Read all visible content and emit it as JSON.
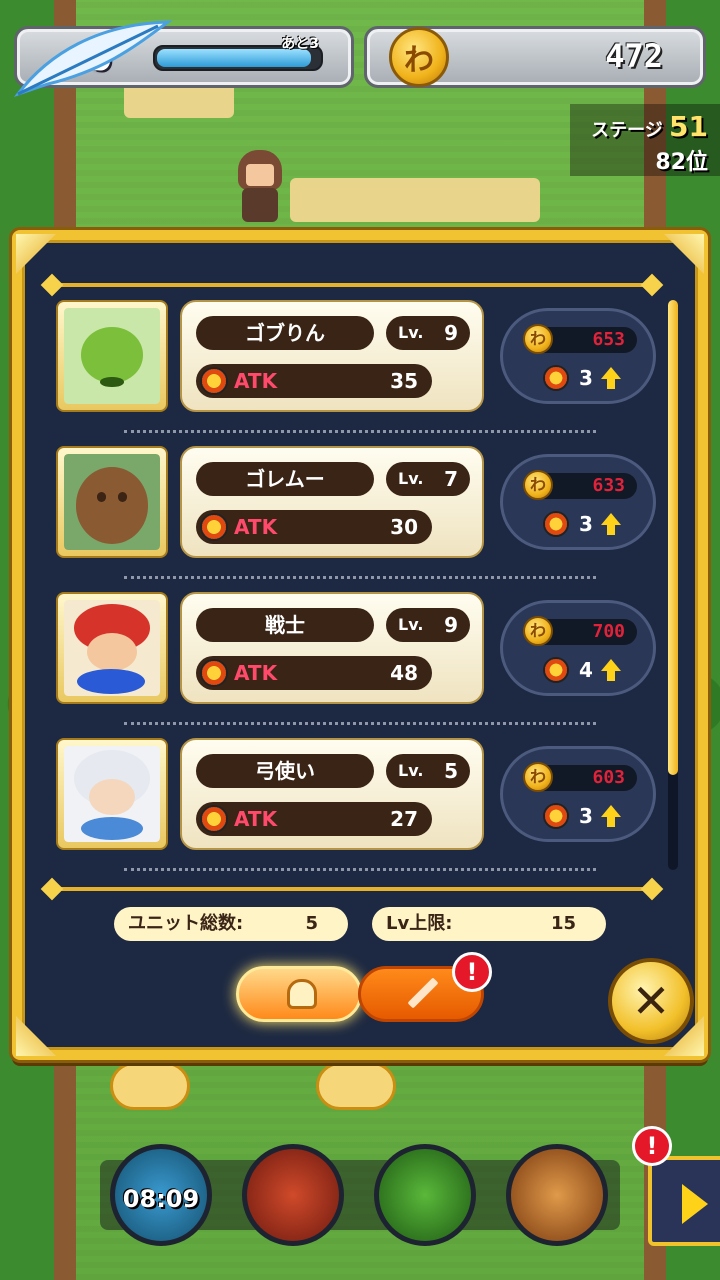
{
  "hud": {
    "level_prefix": "Lv",
    "level": "9",
    "exp_note": "あと3",
    "exp_progress": 0.95,
    "coin_symbol": "わ",
    "coins": "472",
    "stage_label": "ステージ",
    "stage_number": "51",
    "rank": "82位"
  },
  "units": [
    {
      "name": "ゴブりん",
      "lv_label": "Lv.",
      "level": "9",
      "atk_label": "ATK",
      "atk": "35",
      "cost": "653",
      "gain": "3",
      "art": "goblin"
    },
    {
      "name": "ゴレムー",
      "lv_label": "Lv.",
      "level": "7",
      "atk_label": "ATK",
      "atk": "30",
      "cost": "633",
      "gain": "3",
      "art": "golem"
    },
    {
      "name": "戦士",
      "lv_label": "Lv.",
      "level": "9",
      "atk_label": "ATK",
      "atk": "48",
      "cost": "700",
      "gain": "4",
      "art": "warrior"
    },
    {
      "name": "弓使い",
      "lv_label": "Lv.",
      "level": "5",
      "atk_label": "ATK",
      "atk": "27",
      "cost": "603",
      "gain": "3",
      "art": "archer"
    }
  ],
  "footer": {
    "unit_total_label": "ユニット総数:",
    "unit_total": "5",
    "lv_cap_label": "Lv上限:",
    "lv_cap": "15"
  },
  "tabs": {
    "unit_tab_icon": "helmet-icon",
    "weapon_tab_icon": "sword-icon",
    "weapon_badge": "!"
  },
  "close_symbol": "✕",
  "skills": {
    "timer": "08:09",
    "next_badge": "!",
    "icons": [
      "clock-skill-icon",
      "bomb-skill-icon",
      "horn-skill-icon",
      "coin-skill-icon"
    ]
  },
  "colors": {
    "panel_bg": "#1d2842",
    "gold": "#f1c232",
    "cost_red": "#e0233a",
    "atk_pink": "#ff4a6b"
  }
}
